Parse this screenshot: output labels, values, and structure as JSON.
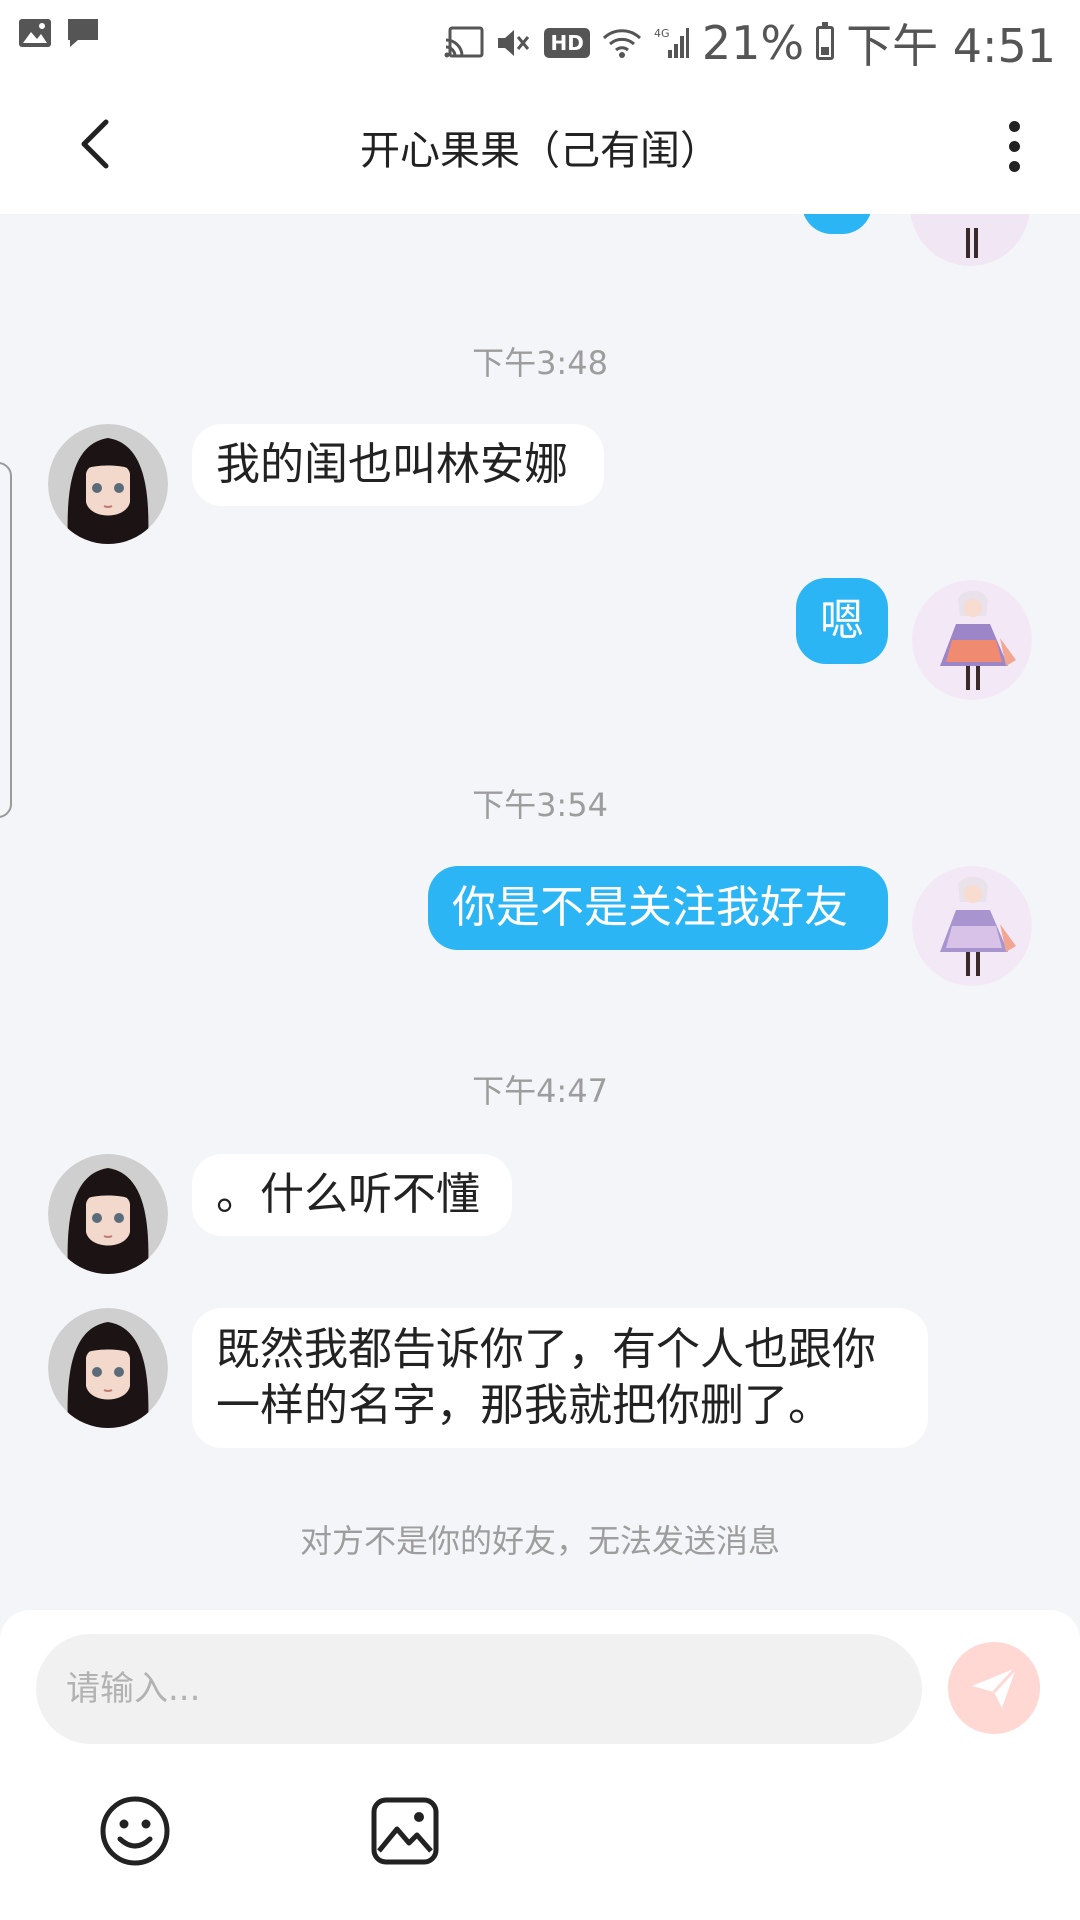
{
  "status_bar": {
    "battery_percent": "21%",
    "time": "下午 4:51",
    "network": "4G",
    "hd": "HD"
  },
  "header": {
    "title": "开心果果（己有闺）"
  },
  "messages": {
    "time_1": "下午3:48",
    "msg_1": "我的闺也叫林安娜",
    "msg_2": "嗯",
    "time_2": "下午3:54",
    "msg_3": "你是不是关注我好友",
    "time_3": "下午4:47",
    "msg_4": "。什么听不懂",
    "msg_5_line_1": "既然我都告诉你了，有个人也跟你",
    "msg_5_line_2": "一样的名字，那我就把你删了。",
    "notice": "对方不是你的好友，无法发送消息"
  },
  "input": {
    "placeholder": "请输入..."
  },
  "colors": {
    "accent": "#2bb5f5",
    "send_button": "#ffd7d3",
    "background": "#f4f5f8"
  },
  "icons": {
    "back": "back-chevron-icon",
    "more": "more-vertical-icon",
    "send": "send-icon",
    "emoji": "emoji-icon",
    "image": "image-icon"
  }
}
